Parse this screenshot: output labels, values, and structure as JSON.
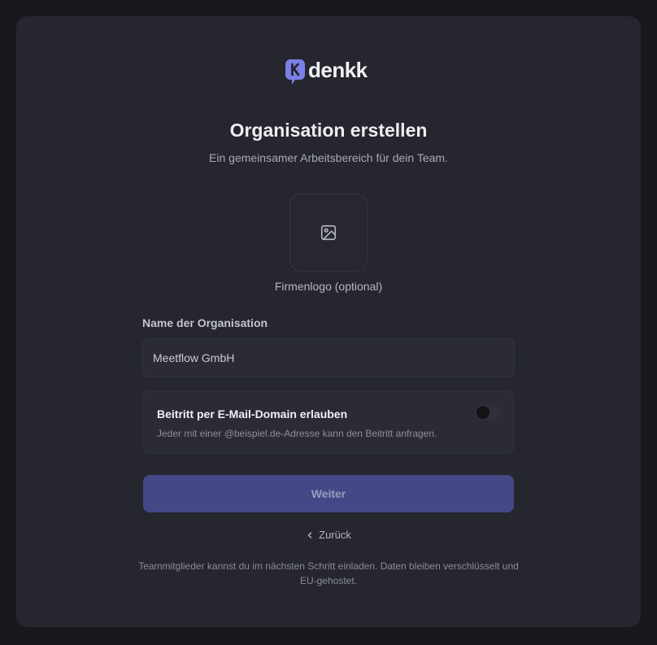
{
  "brand": {
    "name": "denkk",
    "accent": "#7b7fe8"
  },
  "page": {
    "title": "Organisation erstellen",
    "subtitle": "Ein gemeinsamer Arbeitsbereich für dein Team."
  },
  "logo_upload": {
    "icon": "image-icon",
    "label": "Firmenlogo (optional)"
  },
  "org_name": {
    "label": "Name der Organisation",
    "value": "Meetflow GmbH"
  },
  "domain_join": {
    "title": "Beitritt per E-Mail-Domain erlauben",
    "description": "Jeder mit einer @beispiel.de-Adresse kann den Beitritt anfragen.",
    "enabled": false
  },
  "actions": {
    "continue_label": "Weiter",
    "back_label": "Zurück",
    "back_icon": "chevron-left-icon"
  },
  "footer": {
    "note": "Teammitglieder kannst du im nächsten Schritt einladen. Daten bleiben verschlüsselt und EU-gehostet."
  }
}
